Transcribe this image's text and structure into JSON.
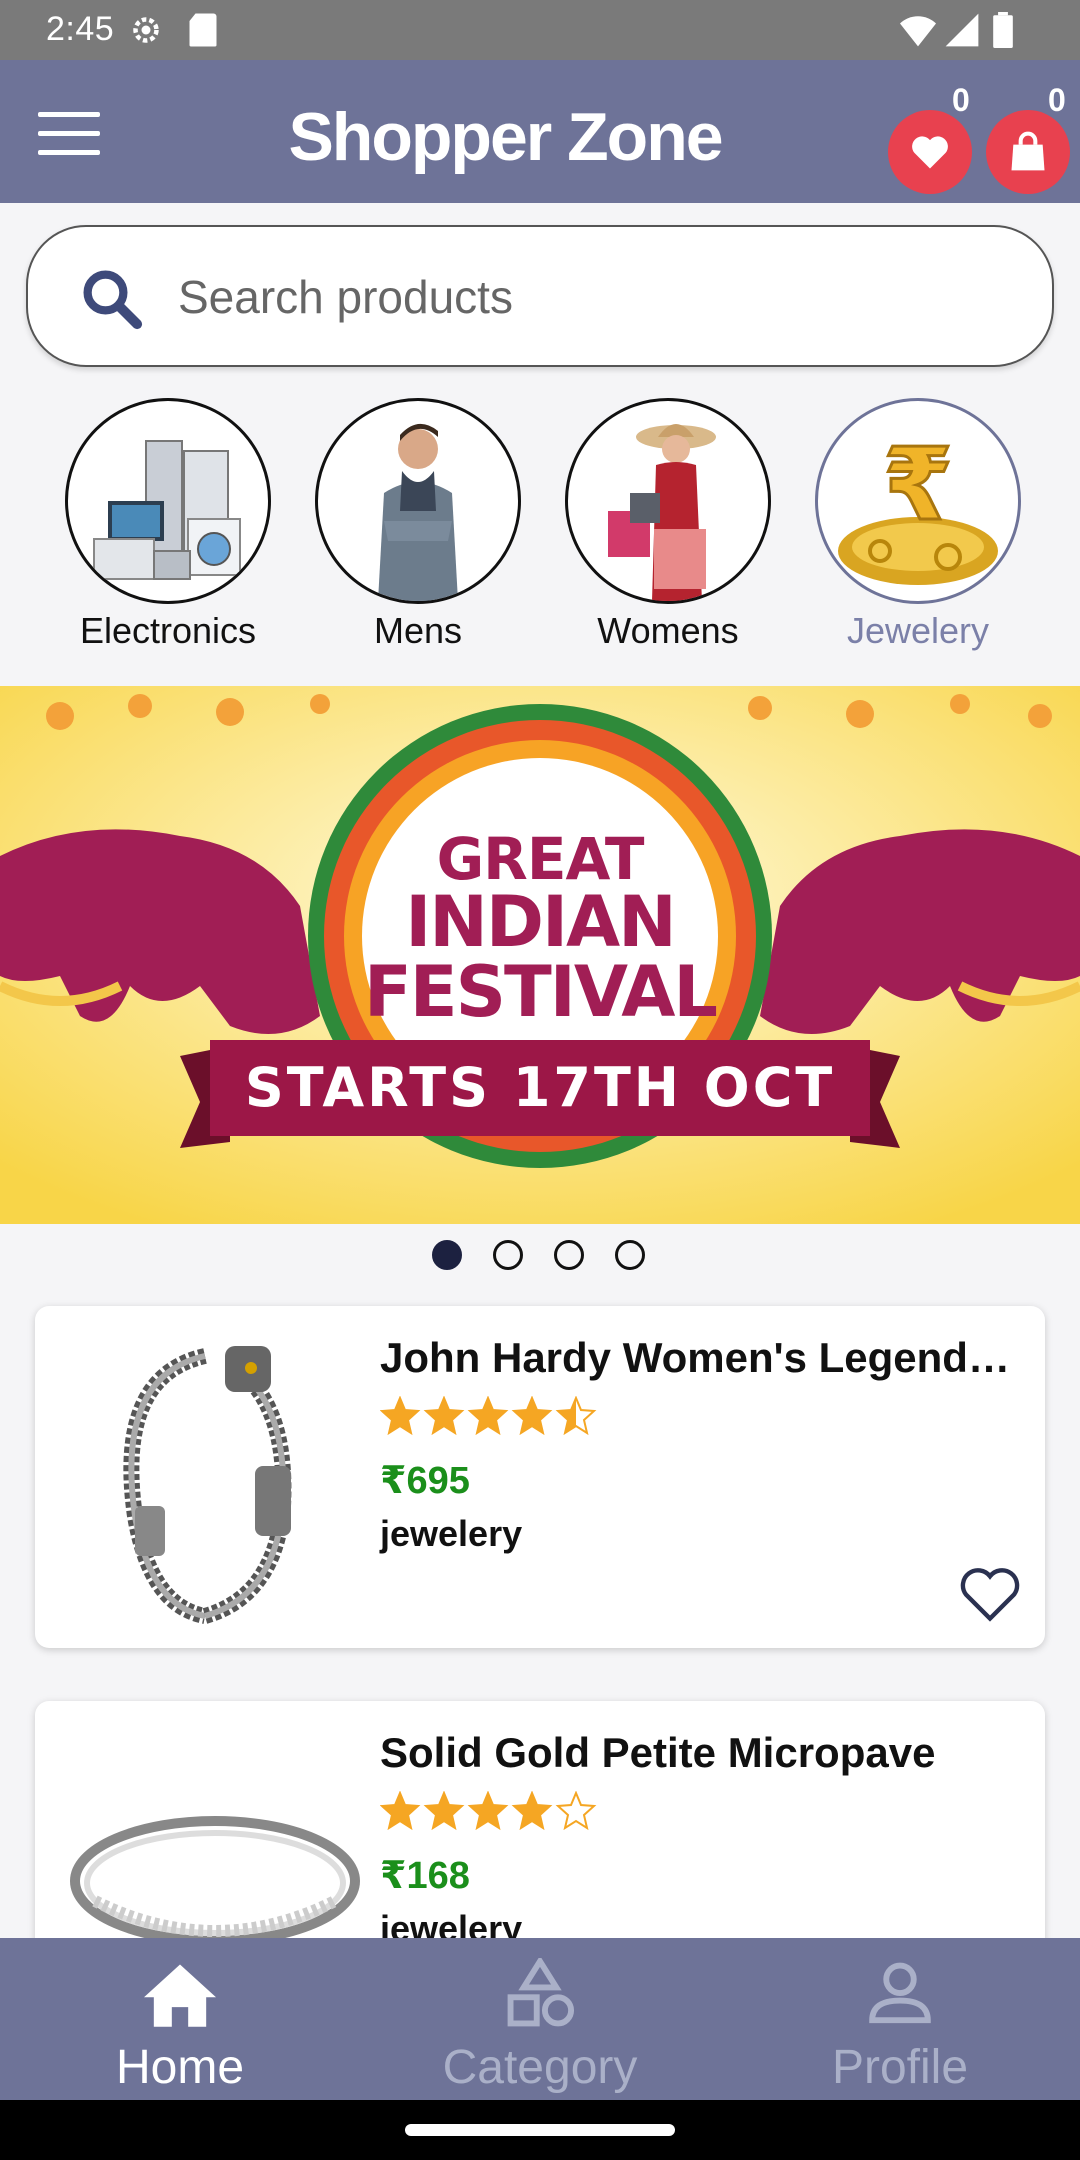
{
  "status_bar": {
    "time": "2:45"
  },
  "app_bar": {
    "title": "Shopper Zone",
    "wishlist_count": "0",
    "cart_count": "0"
  },
  "search": {
    "placeholder": "Search products"
  },
  "categories": [
    {
      "label": "Electronics",
      "icon": "appliances-image"
    },
    {
      "label": "Mens",
      "icon": "man-image"
    },
    {
      "label": "Womens",
      "icon": "woman-image"
    },
    {
      "label": "Jewelery",
      "icon": "gold-rupee-image",
      "active": true
    }
  ],
  "banner": {
    "line1": "GREAT",
    "line2": "INDIAN",
    "line3": "FESTIVAL",
    "ribbon": "STARTS 17TH OCT",
    "active_slide": 1,
    "slide_count": 4
  },
  "products": [
    {
      "name": "John Hardy Women's Legends Naga",
      "rating": 4.5,
      "price": "₹695",
      "category": "jewelery"
    },
    {
      "name": "Solid Gold Petite Micropave",
      "rating": 4.0,
      "price": "₹168",
      "category": "jewelery"
    }
  ],
  "bottom_nav": {
    "items": [
      {
        "label": "Home",
        "icon": "home-icon",
        "active": true
      },
      {
        "label": "Category",
        "icon": "category-icon"
      },
      {
        "label": "Profile",
        "icon": "profile-icon"
      }
    ]
  },
  "colors": {
    "primary": "#6e7398",
    "badge": "#e8414f",
    "price": "#1b8f1b",
    "star": "#f5a623"
  }
}
